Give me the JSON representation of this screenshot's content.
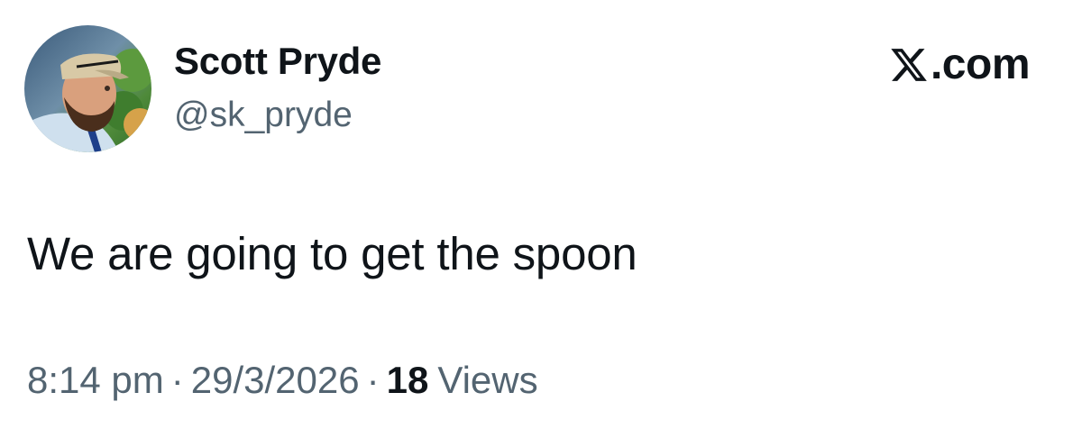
{
  "author": {
    "display_name": "Scott Pryde",
    "handle": "@sk_pryde"
  },
  "brand": {
    "icon": "x-logo-icon",
    "text": ".com"
  },
  "tweet": {
    "text": "We are going to get the spoon"
  },
  "meta": {
    "time": "8:14 pm",
    "separator": "·",
    "date": "29/3/2026",
    "views_count": "18",
    "views_label": "Views"
  },
  "colors": {
    "primary_text": "#0f1419",
    "secondary_text": "#536471",
    "background": "#ffffff"
  }
}
